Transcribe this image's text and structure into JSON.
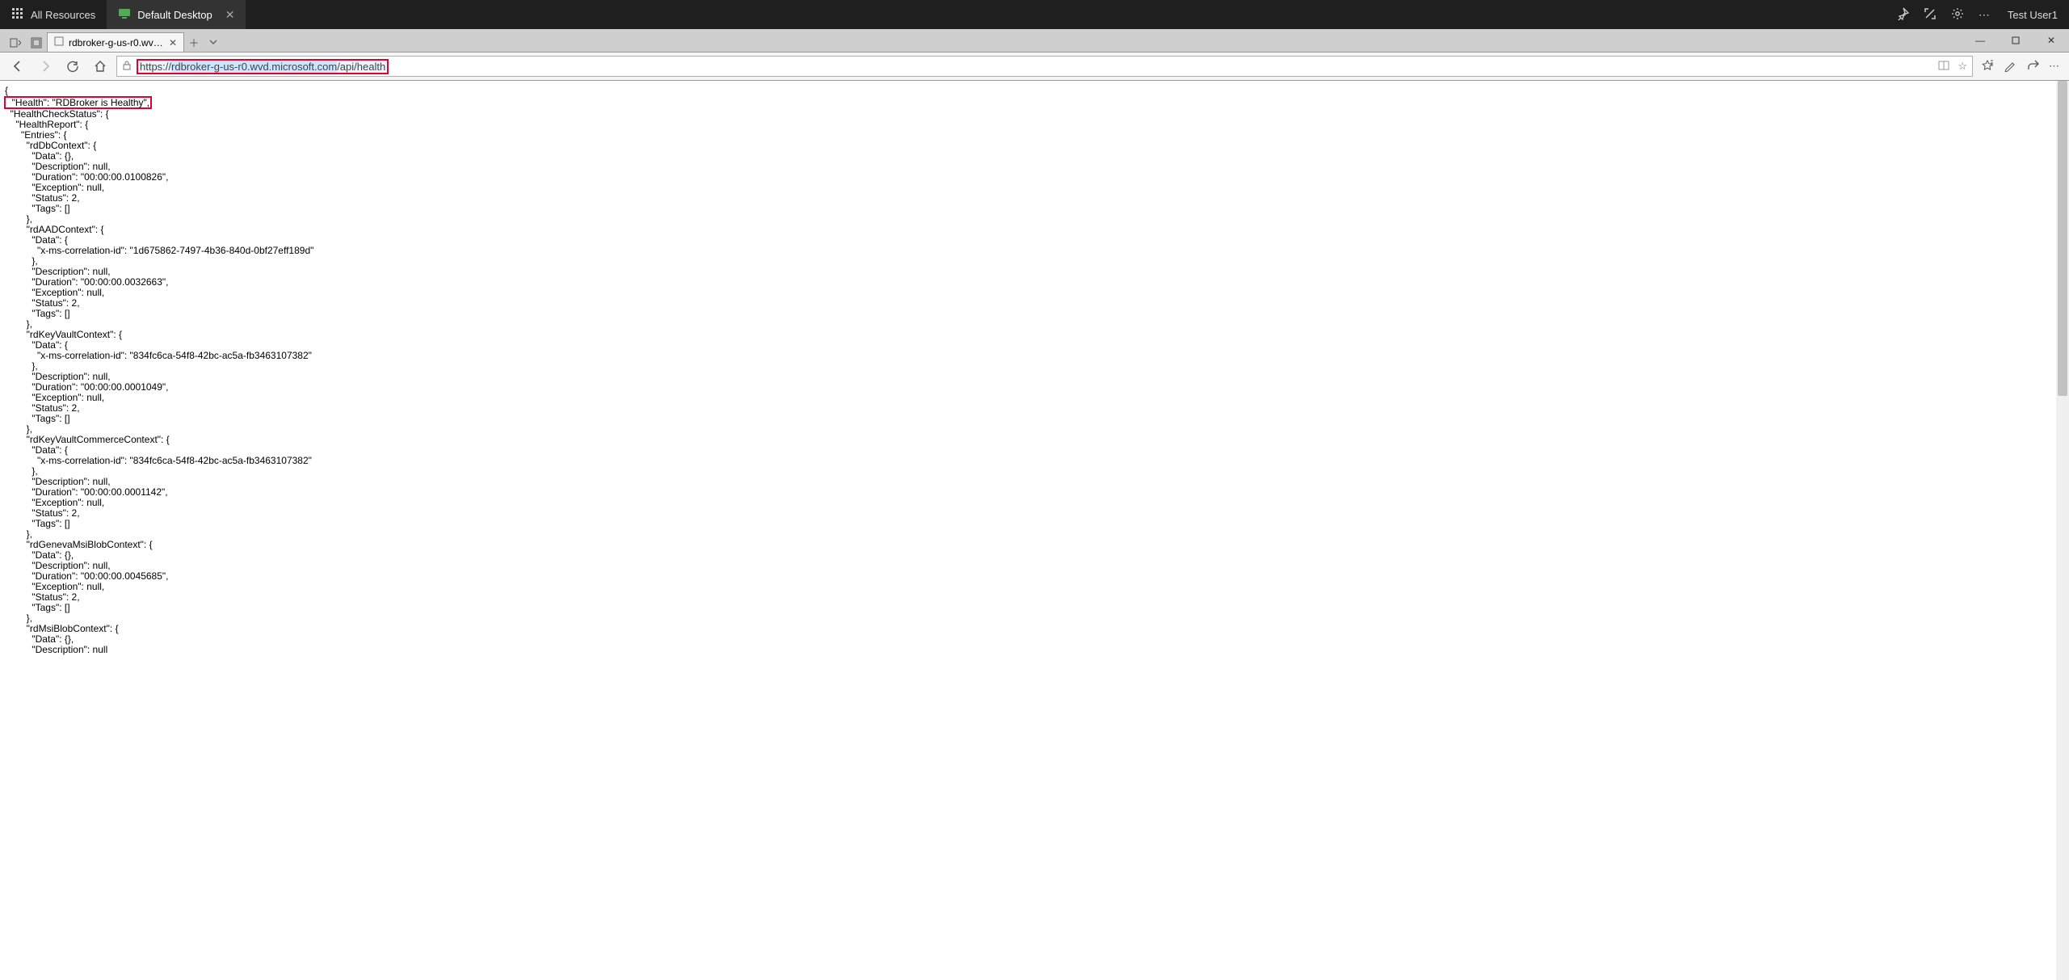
{
  "rd": {
    "tab1": "All Resources",
    "tab2": "Default Desktop",
    "user": "Test User1"
  },
  "browser": {
    "tab_title": "rdbroker-g-us-r0.wvd.m",
    "url_full": "https://rdbroker-g-us-r0.wvd.microsoft.com/api/health",
    "url_host": "rdbroker-g-us-r0.wvd.microsoft.com",
    "url_path": "/api/health"
  },
  "json": {
    "brace_open": "{",
    "health_line": "  \"Health\": \"RDBroker is Healthy\",",
    "rest": "  \"HealthCheckStatus\": {\n    \"HealthReport\": {\n      \"Entries\": {\n        \"rdDbContext\": {\n          \"Data\": {},\n          \"Description\": null,\n          \"Duration\": \"00:00:00.0100826\",\n          \"Exception\": null,\n          \"Status\": 2,\n          \"Tags\": []\n        },\n        \"rdAADContext\": {\n          \"Data\": {\n            \"x-ms-correlation-id\": \"1d675862-7497-4b36-840d-0bf27eff189d\"\n          },\n          \"Description\": null,\n          \"Duration\": \"00:00:00.0032663\",\n          \"Exception\": null,\n          \"Status\": 2,\n          \"Tags\": []\n        },\n        \"rdKeyVaultContext\": {\n          \"Data\": {\n            \"x-ms-correlation-id\": \"834fc6ca-54f8-42bc-ac5a-fb3463107382\"\n          },\n          \"Description\": null,\n          \"Duration\": \"00:00:00.0001049\",\n          \"Exception\": null,\n          \"Status\": 2,\n          \"Tags\": []\n        },\n        \"rdKeyVaultCommerceContext\": {\n          \"Data\": {\n            \"x-ms-correlation-id\": \"834fc6ca-54f8-42bc-ac5a-fb3463107382\"\n          },\n          \"Description\": null,\n          \"Duration\": \"00:00:00.0001142\",\n          \"Exception\": null,\n          \"Status\": 2,\n          \"Tags\": []\n        },\n        \"rdGenevaMsiBlobContext\": {\n          \"Data\": {},\n          \"Description\": null,\n          \"Duration\": \"00:00:00.0045685\",\n          \"Exception\": null,\n          \"Status\": 2,\n          \"Tags\": []\n        },\n        \"rdMsiBlobContext\": {\n          \"Data\": {},\n          \"Description\": null"
  }
}
